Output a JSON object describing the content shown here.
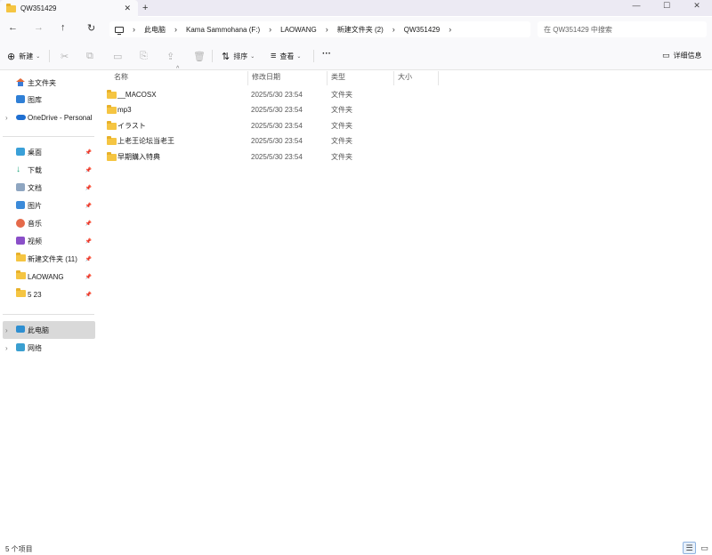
{
  "tab": {
    "title": "QW351429",
    "close": "✕",
    "new": "+"
  },
  "window_controls": {
    "minimize": "—",
    "maximize": "☐",
    "close": "✕"
  },
  "nav": {
    "back": "←",
    "forward": "→",
    "up": "↑",
    "refresh": "↻"
  },
  "breadcrumb": [
    "此电脑",
    "Kama Sammohana (F:)",
    "LAOWANG",
    "新建文件夹 (2)",
    "QW351429"
  ],
  "search": {
    "placeholder": "在 QW351429 中搜索"
  },
  "commandbar": {
    "new_label": "新建",
    "sort_label": "排序",
    "view_label": "查看",
    "more": "···",
    "details_label": "详细信息",
    "icons": [
      "cut-icon",
      "copy-icon",
      "paste-icon",
      "rename-icon",
      "share-icon",
      "delete-icon"
    ]
  },
  "sidebar": {
    "top": [
      {
        "label": "主文件夹",
        "icon": "home-icon"
      },
      {
        "label": "图库",
        "icon": "gallery-icon"
      },
      {
        "label": "OneDrive - Personal",
        "icon": "cloud-icon"
      }
    ],
    "pinned": [
      {
        "label": "桌面",
        "icon": "desktop-icon"
      },
      {
        "label": "下载",
        "icon": "download-icon"
      },
      {
        "label": "文档",
        "icon": "documents-icon"
      },
      {
        "label": "图片",
        "icon": "pictures-icon"
      },
      {
        "label": "音乐",
        "icon": "music-icon"
      },
      {
        "label": "视频",
        "icon": "videos-icon"
      },
      {
        "label": "新建文件夹 (11)",
        "icon": "folder-icon"
      },
      {
        "label": "LAOWANG",
        "icon": "folder-icon"
      },
      {
        "label": "5 23",
        "icon": "folder-icon"
      }
    ],
    "bottom": [
      {
        "label": "此电脑",
        "icon": "pc-icon"
      },
      {
        "label": "网络",
        "icon": "network-icon"
      }
    ]
  },
  "columns": {
    "name": "名称",
    "date": "修改日期",
    "type": "类型",
    "size": "大小"
  },
  "files": [
    {
      "name": "__MACOSX",
      "date": "2025/5/30 23:54",
      "type": "文件夹"
    },
    {
      "name": "mp3",
      "date": "2025/5/30 23:54",
      "type": "文件夹"
    },
    {
      "name": "イラスト",
      "date": "2025/5/30 23:54",
      "type": "文件夹"
    },
    {
      "name": "上老王论坛当老王",
      "date": "2025/5/30 23:54",
      "type": "文件夹"
    },
    {
      "name": "早期購入特典",
      "date": "2025/5/30 23:54",
      "type": "文件夹"
    }
  ],
  "status": {
    "count": "5 个项目"
  },
  "colors": {
    "folder": "#f5c542",
    "accent": "#1f6fd1",
    "selected": "#d9d9d9"
  }
}
